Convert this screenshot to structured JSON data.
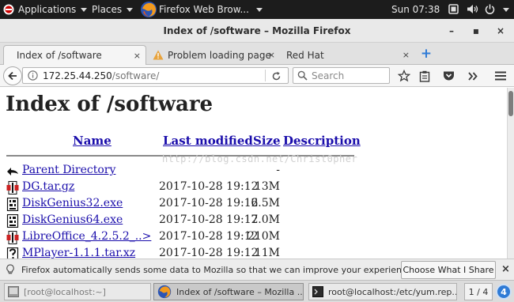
{
  "topbar": {
    "applications": "Applications",
    "places": "Places",
    "active_app": "Firefox Web Brow...",
    "clock": "Sun 07:38"
  },
  "window": {
    "title": "Index of /software – Mozilla Firefox",
    "minimize": "–",
    "maximize": "▪",
    "close": "×"
  },
  "tabs": [
    {
      "label": "Index of /software",
      "close": "×"
    },
    {
      "label": "Problem loading page",
      "close": "×"
    },
    {
      "label": "Red Hat",
      "close": "×"
    }
  ],
  "new_tab": "+",
  "nav": {
    "url_host": "172.25.44.250",
    "url_path": "/software/",
    "search_placeholder": "Search"
  },
  "page": {
    "title": "Index of /software",
    "columns": {
      "name": "Name",
      "modified": "Last modified",
      "size": "Size",
      "description": "Description"
    },
    "watermark": "http://blog.csdn.net/Christ0pher",
    "parent": {
      "name": "Parent Directory",
      "size": "-"
    },
    "files": [
      {
        "name": "DG.tar.gz",
        "modified": "2017-10-28 19:12",
        "size": "13M",
        "icon": "compressed-icon"
      },
      {
        "name": "DiskGenius32.exe",
        "modified": "2017-10-28 19:12",
        "size": "6.5M",
        "icon": "binary-icon"
      },
      {
        "name": "DiskGenius64.exe",
        "modified": "2017-10-28 19:12",
        "size": "7.0M",
        "icon": "binary-icon"
      },
      {
        "name": "LibreOffice_4.2.5.2_..>",
        "modified": "2017-10-28 19:12",
        "size": "210M",
        "icon": "compressed-icon"
      },
      {
        "name": "MPlayer-1.1.1.tar.xz",
        "modified": "2017-10-28 19:12",
        "size": "11M",
        "icon": "unknown-icon"
      }
    ]
  },
  "notification": {
    "text": "Firefox automatically sends some data to Mozilla so that we can improve your experience.",
    "button": "Choose What I Share",
    "close": "×"
  },
  "taskbar": {
    "items": [
      {
        "label": "[root@localhost:~]"
      },
      {
        "label": "Index of /software – Mozilla ..."
      },
      {
        "label": "root@localhost:/etc/yum.rep..."
      }
    ],
    "workspace": "1 / 4",
    "workspace_badge": "4"
  },
  "colors": {
    "link": "#1a0dab",
    "topbar": "#1c1c1c",
    "accent": "#2f7bd6",
    "warning": "#e8a33d"
  }
}
